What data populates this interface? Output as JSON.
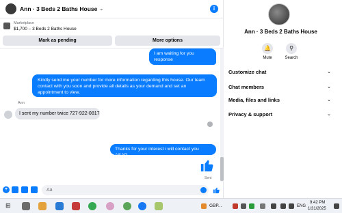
{
  "chat": {
    "title": "Ann · 3 Beds 2 Baths House",
    "marketplace_label": "Marketplace",
    "listing": "$1,700 – 3 Beds 2 Baths House",
    "mark_pending": "Mark as pending",
    "more_options": "More options"
  },
  "messages": [
    {
      "direction": "out",
      "text": "I am waiting for you response"
    },
    {
      "direction": "out",
      "text": "Kindly send me your number for more information regarding this house. Our team contact with you soon and provide all details as your demand and set an appointment to view."
    },
    {
      "direction": "in",
      "sender": "Ann",
      "text": "I sent my number twice 727-922-0817"
    },
    {
      "direction": "out",
      "text": "Thanks for your interest i will contact you ASAP."
    }
  ],
  "status": {
    "sent": "Sent"
  },
  "composer": {
    "placeholder": "Aa"
  },
  "panel": {
    "title": "Ann · 3 Beds 2 Baths House",
    "mute": "Mute",
    "search": "Search",
    "sections": [
      "Customize chat",
      "Chat members",
      "Media, files and links",
      "Privacy & support"
    ]
  },
  "taskbar": {
    "currency": "GBP...",
    "lang": "ENG",
    "time": "9:42 PM",
    "date": "1/31/2025"
  },
  "colors": {
    "accent": "#0a7cff",
    "bubble_in": "#e4e6eb"
  }
}
